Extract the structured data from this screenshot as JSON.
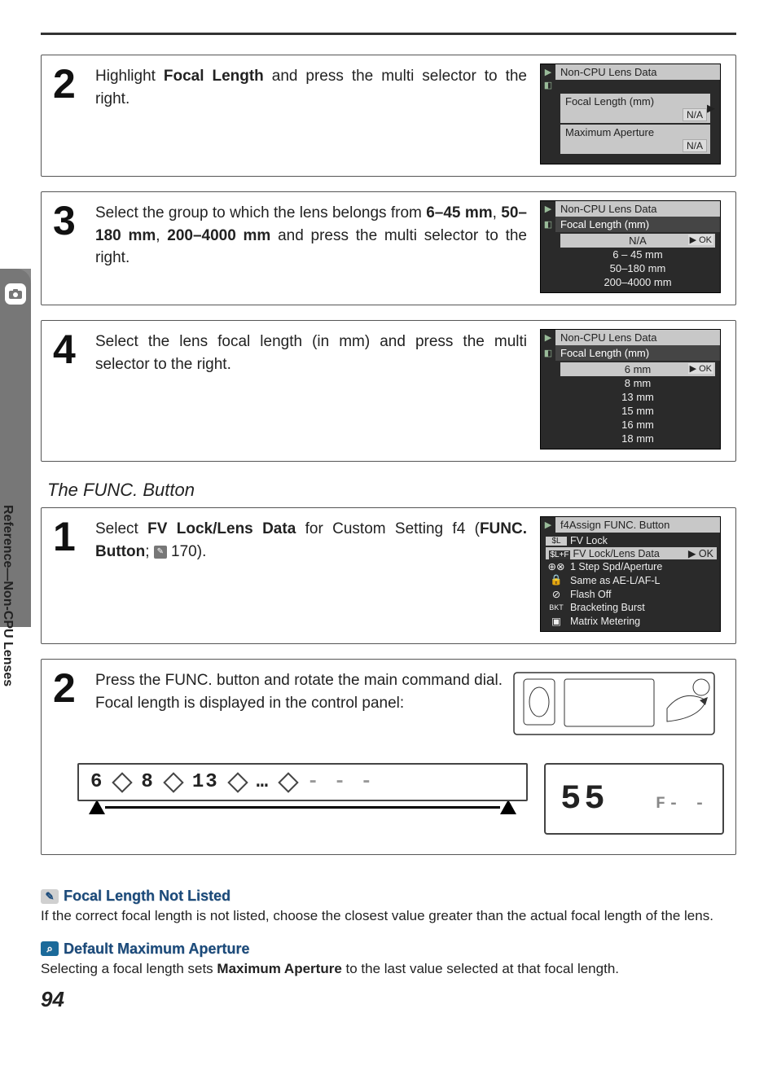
{
  "sideTab": {
    "label": "Reference—Non-CPU Lenses"
  },
  "pageNumber": "94",
  "steps": {
    "s2": {
      "num": "2",
      "text_pre": "Highlight ",
      "text_bold": "Focal Length",
      "text_post": " and press the multi selector to the right."
    },
    "s3": {
      "num": "3",
      "text_pre": "Select the group to which the lens belongs from ",
      "g1": "6–45 mm",
      "comma1": ", ",
      "g2": "50–180 mm",
      "comma2": ", ",
      "g3": "200–4000 mm",
      "tail": " and press the multi selector to the right."
    },
    "s4": {
      "num": "4",
      "text": "Select the lens focal length (in mm) and press the multi selector to the right."
    },
    "f1": {
      "num": "1",
      "pre": "Select ",
      "opt": "FV Lock/Lens Data",
      "mid": " for Custom Setting f4 (",
      "btn": "FUNC. Button",
      "semi": "; ",
      "pg": "170",
      "end": ")."
    },
    "f2": {
      "num": "2",
      "text": "Press the FUNC. button and rotate the main command dial.  Focal length is displayed in the control panel:"
    }
  },
  "funcHeading": "The FUNC. Button",
  "lcd2": {
    "title": "Non-CPU Lens Data",
    "field1": "Focal Length (mm)",
    "val1": "N/A",
    "field2": "Maximum Aperture",
    "val2": "N/A"
  },
  "lcd3": {
    "title": "Non-CPU Lens Data",
    "sub": "Focal Length (mm)",
    "items": [
      "N/A",
      "6 – 45 mm",
      "50–180 mm",
      "200–4000 mm"
    ],
    "ok": "▶ OK"
  },
  "lcd4": {
    "title": "Non-CPU Lens Data",
    "sub": "Focal Length (mm)",
    "items": [
      "6 mm",
      "8 mm",
      "13 mm",
      "15 mm",
      "16 mm",
      "18 mm"
    ],
    "ok": "▶ OK"
  },
  "lcdFunc": {
    "title": "f4Assign FUNC. Button",
    "items": [
      "FV Lock",
      "FV Lock/Lens Data",
      "1 Step Spd/Aperture",
      "Same as AE-L/AF-L",
      "Flash Off",
      "Bracketing Burst",
      "Matrix Metering"
    ],
    "ok": "▶ OK"
  },
  "segStrip": {
    "a": "6",
    "b": "8",
    "c": "13",
    "dots": "…",
    "dash": "- - -"
  },
  "segBig": {
    "val": "55",
    "f": "F- -"
  },
  "note1": {
    "head": "Focal Length Not Listed",
    "body": "If the correct focal length is not listed, choose the closest value greater than the actual focal length of the lens."
  },
  "note2": {
    "head": "Default Maximum Aperture",
    "pre": "Selecting a focal length sets ",
    "bold": "Maximum Aperture",
    "post": " to the last value selected at that focal length."
  }
}
